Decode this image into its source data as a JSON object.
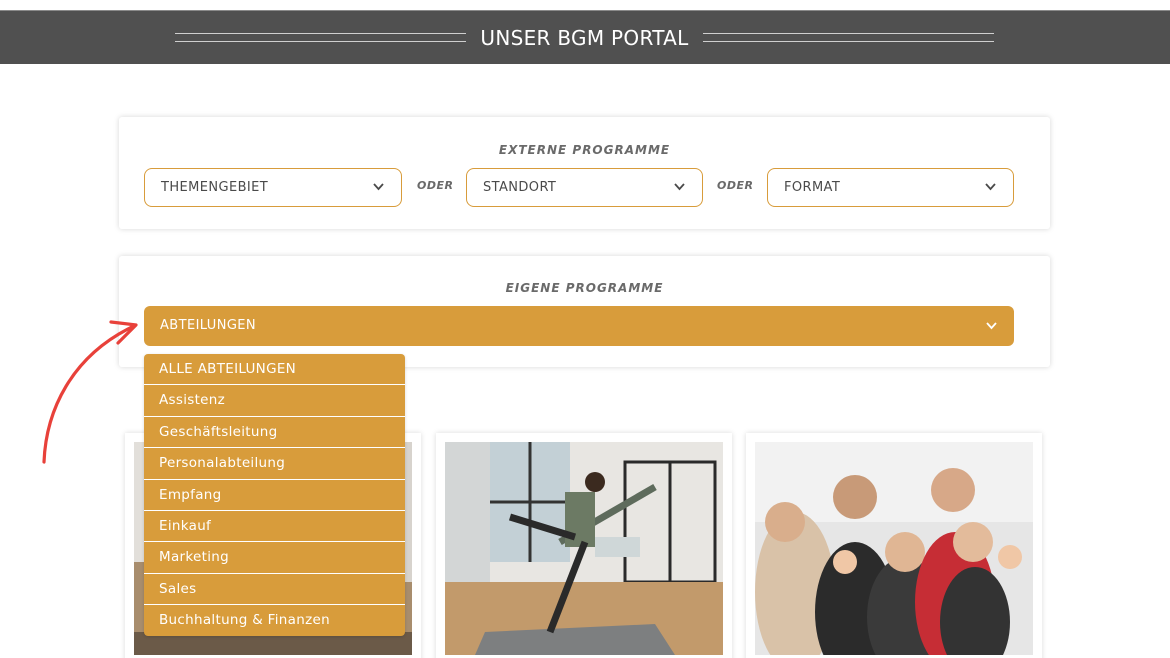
{
  "header": {
    "title": "UNSER BGM PORTAL"
  },
  "externe": {
    "heading": "EXTERNE PROGRAMME",
    "select_theme": "THEMENGEBIET",
    "oder_1": "ODER",
    "select_standort": "STANDORT",
    "oder_2": "ODER",
    "select_format": "FORMAT"
  },
  "eigene": {
    "heading": "EIGENE PROGRAMME",
    "select_dept": "ABTEILUNGEN"
  },
  "dropdown": {
    "options": [
      "ALLE ABTEILUNGEN",
      "Assistenz",
      "Geschäftsleitung",
      "Personalabteilung",
      "Empfang",
      "Einkauf",
      "Marketing",
      "Sales",
      "Buchhaltung & Finanzen"
    ]
  },
  "colors": {
    "accent": "#d89c3b",
    "header_bg": "#505050",
    "arrow": "#e8413a"
  },
  "icons": {
    "select_chevron": "chevron-down-icon",
    "annotation": "curved-arrow-icon"
  }
}
